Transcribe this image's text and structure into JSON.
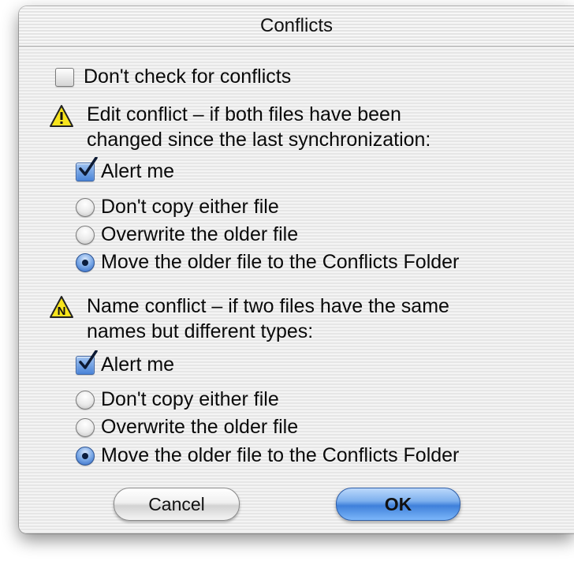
{
  "window": {
    "title": "Conflicts"
  },
  "dont_check": {
    "label": "Don't check for conflicts",
    "checked": false
  },
  "edit_conflict": {
    "icon": "warning-icon",
    "description_line1": "Edit conflict – if both files have been",
    "description_line2": "changed since the last synchronization:",
    "alert_me": {
      "label": "Alert me",
      "checked": true
    },
    "options": [
      {
        "label": "Don't copy either file",
        "selected": false
      },
      {
        "label": "Overwrite the older file",
        "selected": false
      },
      {
        "label": "Move the older file to the Conflicts Folder",
        "selected": true
      }
    ]
  },
  "name_conflict": {
    "icon": "name-warning-icon",
    "icon_letter": "N",
    "description_line1": "Name conflict – if two files have the same",
    "description_line2": "names but different types:",
    "alert_me": {
      "label": "Alert me",
      "checked": true
    },
    "options": [
      {
        "label": "Don't copy either file",
        "selected": false
      },
      {
        "label": "Overwrite the older file",
        "selected": false
      },
      {
        "label": "Move the older file to the Conflicts Folder",
        "selected": true
      }
    ]
  },
  "buttons": {
    "cancel": "Cancel",
    "ok": "OK"
  },
  "colors": {
    "accent": "#3f80da",
    "warning": "#f7e41c"
  }
}
